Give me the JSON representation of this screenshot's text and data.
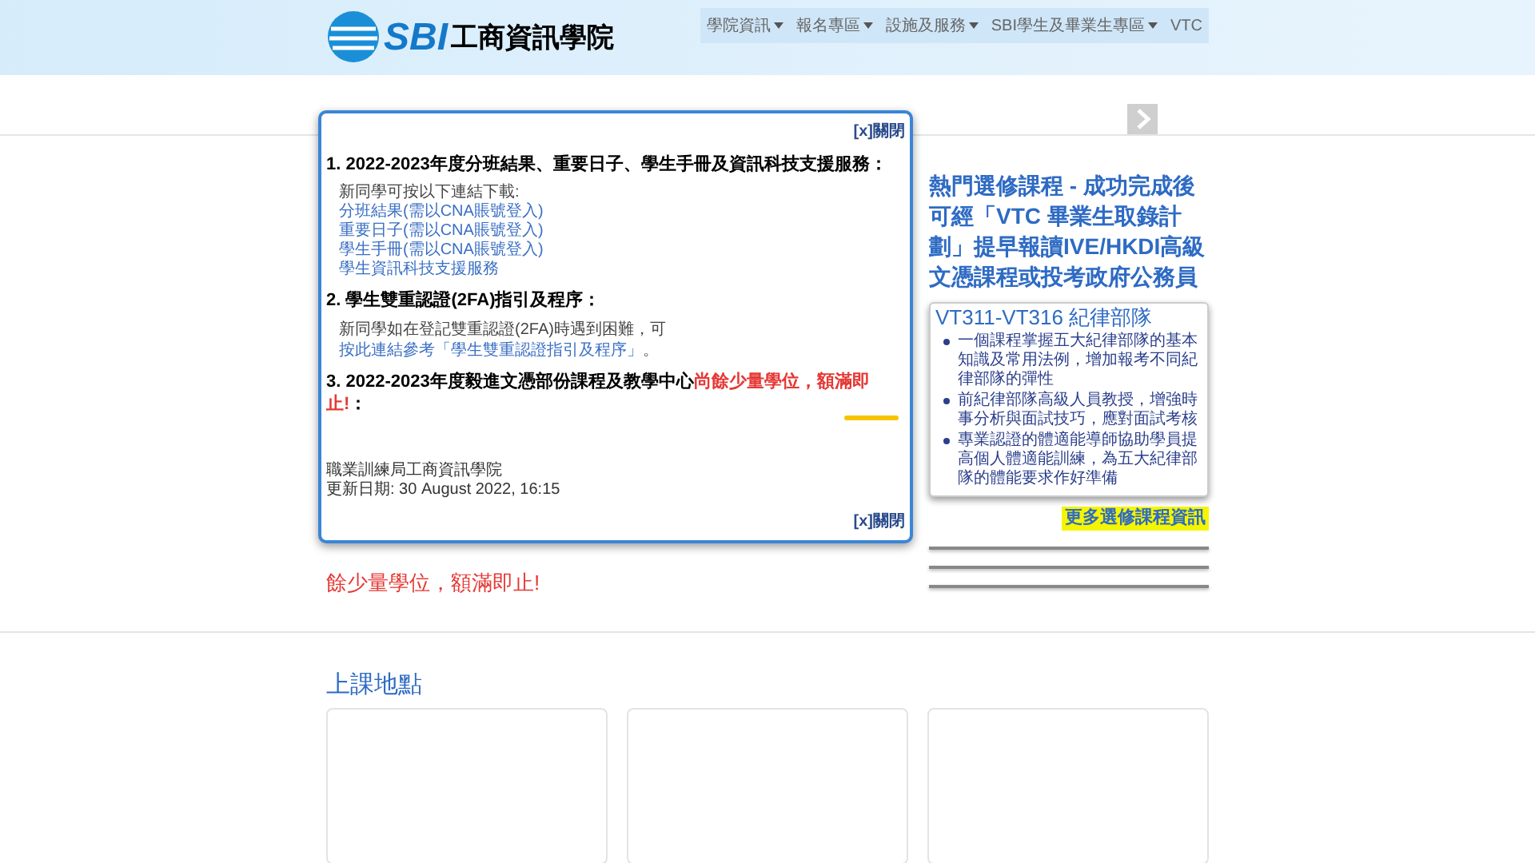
{
  "header": {
    "logo_text": "SBI",
    "school_name": "工商資訊學院"
  },
  "nav": [
    {
      "label": "學院資訊",
      "dropdown": true
    },
    {
      "label": "報名專區",
      "dropdown": true
    },
    {
      "label": "設施及服務",
      "dropdown": true
    },
    {
      "label": "SBI學生及畢業生專區",
      "dropdown": true
    },
    {
      "label": "VTC",
      "dropdown": false
    }
  ],
  "background_notice": "餘少量學位，額滿即止!",
  "promo": {
    "heading": "熱門選修課程 - 成功完成後可經「VTC 畢業生取錄計劃」提早報讀IVE/HKDI高級文憑課程或投考政府公務員",
    "card": {
      "title": "VT311-VT316 紀律部隊",
      "points": [
        "一個課程掌握五大紀律部隊的基本知識及常用法例，增加報考不同紀律部隊的彈性",
        "前紀律部隊高級人員教授，增強時事分析與面試技巧，應對面試考核",
        "專業認證的體適能導師協助學員提高個人體適能訓練，為五大紀律部隊的體能要求作好準備"
      ]
    },
    "more_link": "更多選修課程資訊"
  },
  "locations": {
    "title": "上課地點"
  },
  "modal": {
    "close_top": "[x]關閉",
    "close_bottom": "[x]關閉",
    "sections": [
      {
        "heading": "1. 2022-2023年度分班結果、重要日子、學生手冊及資訊科技支援服務：",
        "intro": "新同學可按以下連結下載:",
        "links": [
          "分班結果(需以CNA賬號登入)",
          "重要日子(需以CNA賬號登入)",
          "學生手冊(需以CNA賬號登入)",
          "學生資訊科技支援服務"
        ]
      },
      {
        "heading": "2. 學生雙重認證(2FA)指引及程序：",
        "body_before": "新同學如在登記雙重認證(2FA)時遇到困難，可",
        "body_link": "按此連結參考「學生雙重認證指引及程序」",
        "body_after": "。"
      },
      {
        "heading": "3. 2022-2023年度毅進文憑部份課程及教學中心",
        "heading_alert": "尚餘少量學位，額滿即止!",
        "heading_end": "："
      }
    ],
    "footer_org": "職業訓練局工商資訊學院",
    "footer_updated": "更新日期: 30 August 2022, 16:15"
  }
}
